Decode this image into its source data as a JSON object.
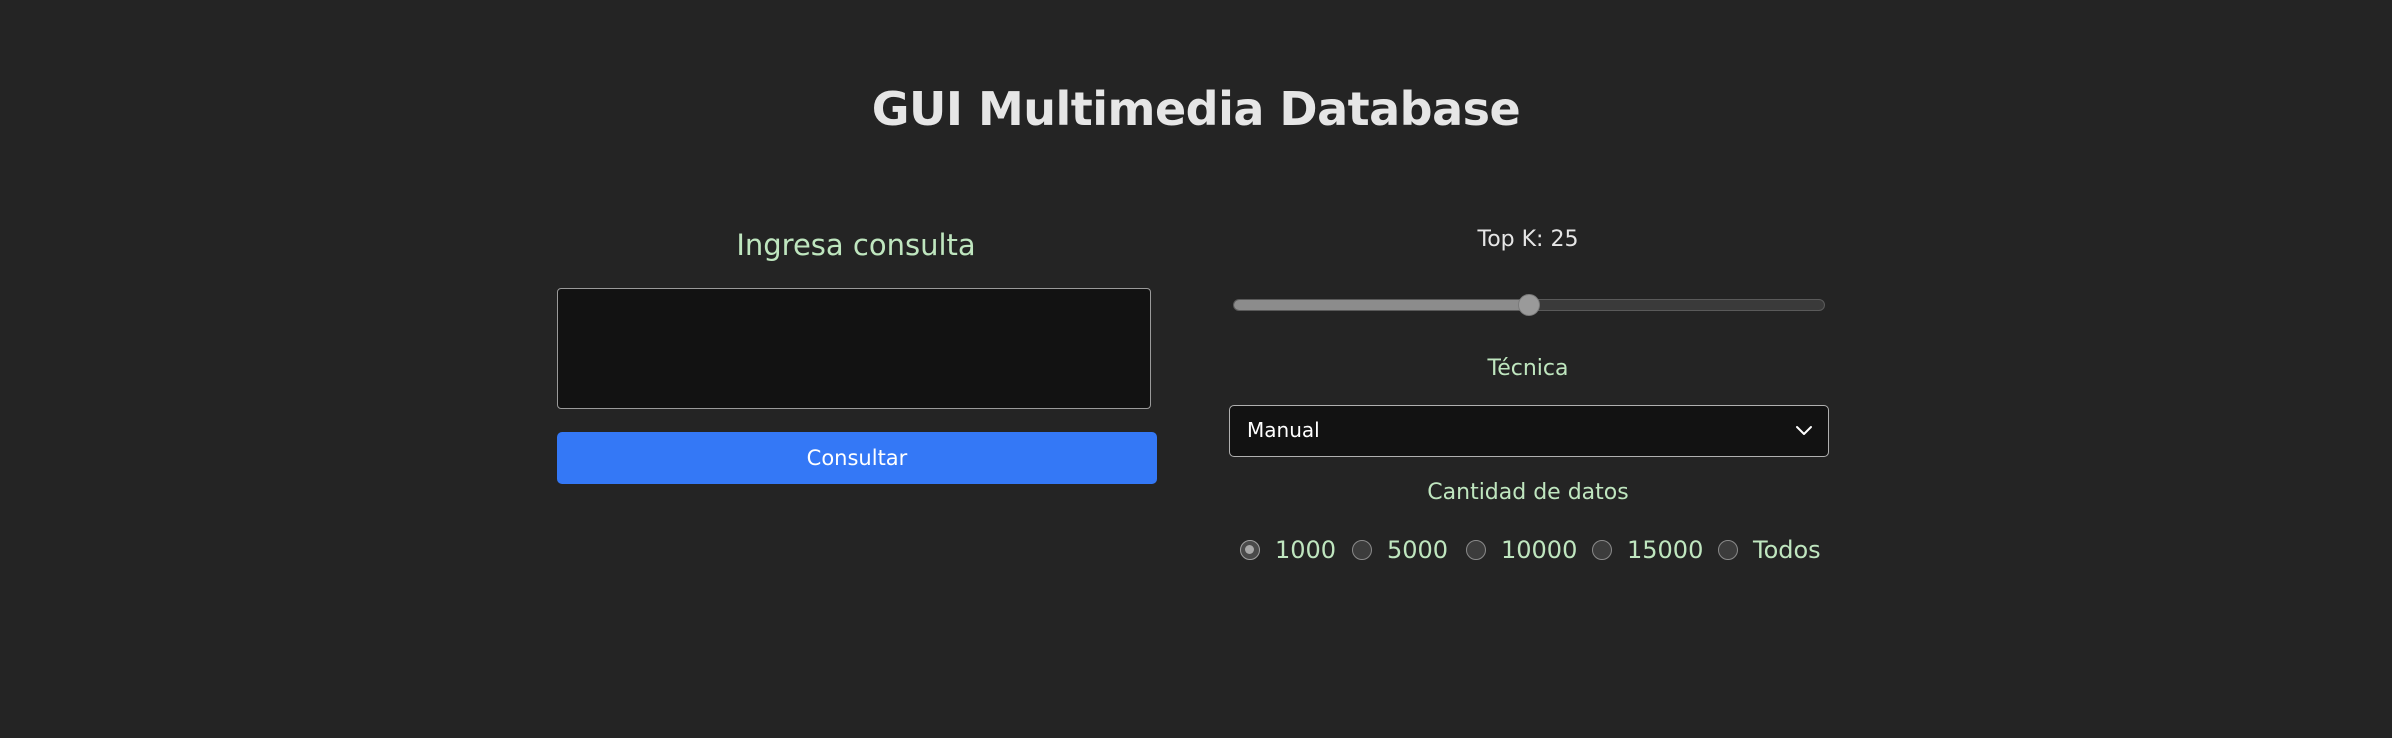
{
  "header": {
    "title": "GUI Multimedia Database"
  },
  "query_panel": {
    "label": "Ingresa consulta",
    "input_value": "",
    "submit_label": "Consultar"
  },
  "topk": {
    "label": "Top K: 25",
    "value": 25,
    "fill_fraction": 0.5
  },
  "technique": {
    "label": "Técnica",
    "selected": "Manual"
  },
  "data_amount": {
    "label": "Cantidad de datos",
    "options": [
      "1000",
      "5000",
      "10000",
      "15000",
      "Todos"
    ],
    "selected": "1000"
  },
  "colors": {
    "background": "#242424",
    "accent_blue": "#3478f6",
    "label_green": "#bfe6bf",
    "input_bg": "#121212"
  },
  "icons": {
    "select_chevron": "chevron-down-icon"
  }
}
